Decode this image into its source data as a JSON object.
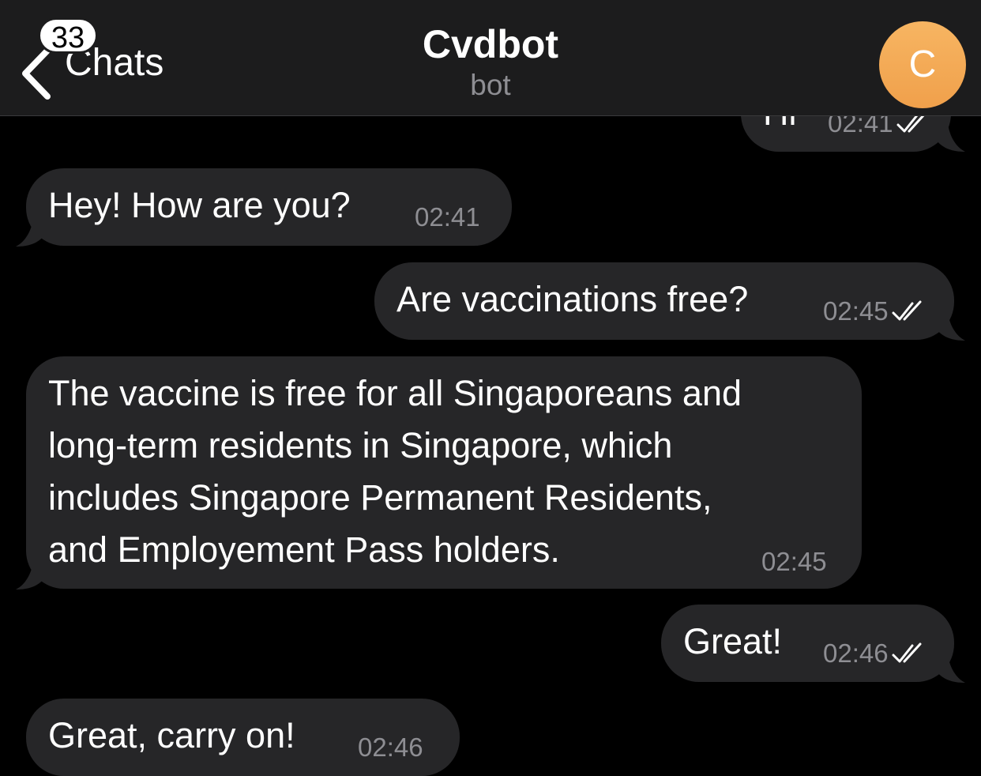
{
  "header": {
    "back_label": "Chats",
    "unread_count": "33",
    "title": "Cvdbot",
    "subtitle": "bot",
    "avatar_letter": "C"
  },
  "messages": [
    {
      "direction": "outgoing",
      "text": "Hi",
      "time": "02:41",
      "read": true
    },
    {
      "direction": "incoming",
      "text": "Hey! How are you?",
      "time": "02:41"
    },
    {
      "direction": "outgoing",
      "text": "Are vaccinations free?",
      "time": "02:45",
      "read": true
    },
    {
      "direction": "incoming",
      "text": "The vaccine is free for all Singaporeans and\nlong-term residents in Singapore, which\nincludes Singapore Permanent Residents,\nand Employement Pass holders.",
      "time": "02:45"
    },
    {
      "direction": "outgoing",
      "text": "Great!",
      "time": "02:46",
      "read": true
    },
    {
      "direction": "incoming",
      "text": "Great, carry on!",
      "time": "02:46"
    }
  ],
  "colors": {
    "background": "#000000",
    "header": "#1c1c1d",
    "bubble": "#262628",
    "meta_text": "#8e8e93",
    "avatar": "#f0a04b"
  }
}
